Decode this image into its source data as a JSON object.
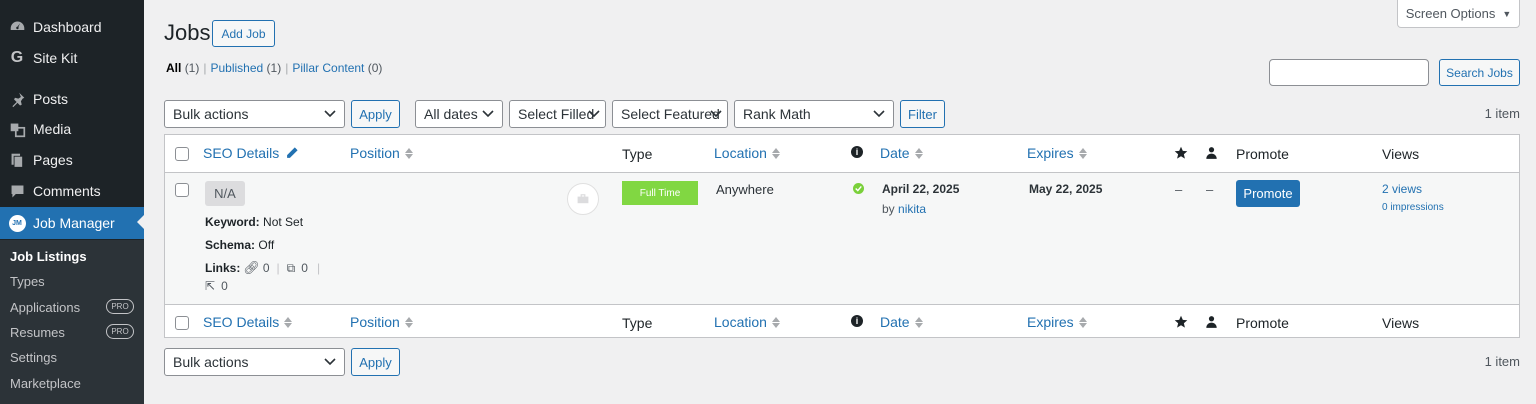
{
  "sidebar": {
    "items": [
      {
        "label": "Dashboard",
        "icon": "dashboard-icon"
      },
      {
        "label": "Site Kit",
        "icon": "google-g-icon"
      },
      {
        "label": "Posts",
        "icon": "pushpin-icon"
      },
      {
        "label": "Media",
        "icon": "media-icon"
      },
      {
        "label": "Pages",
        "icon": "pages-icon"
      },
      {
        "label": "Comments",
        "icon": "comment-icon"
      },
      {
        "label": "Job Manager",
        "icon": "jm-logo-icon"
      }
    ],
    "submenu": [
      {
        "label": "Job Listings"
      },
      {
        "label": "Types"
      },
      {
        "label": "Applications",
        "badge": "PRO"
      },
      {
        "label": "Resumes",
        "badge": "PRO"
      },
      {
        "label": "Settings"
      },
      {
        "label": "Marketplace"
      }
    ]
  },
  "screen_options": "Screen Options",
  "page": {
    "title": "Jobs",
    "add_new": "Add Job"
  },
  "views": {
    "all": "All",
    "all_count": "(1)",
    "published": "Published",
    "published_count": "(1)",
    "pillar": "Pillar Content",
    "pillar_count": "(0)",
    "sep": "|"
  },
  "search": {
    "value": "",
    "button": "Search Jobs"
  },
  "filters": {
    "bulk": "Bulk actions",
    "apply": "Apply",
    "dates": "All dates",
    "filled": "Select Filled",
    "featured": "Select Featured",
    "rankmath": "Rank Math",
    "filter": "Filter",
    "count": "1 item"
  },
  "columns": {
    "seo": "SEO Details",
    "position": "Position",
    "type": "Type",
    "location": "Location",
    "date": "Date",
    "expires": "Expires",
    "promote": "Promote",
    "views": "Views"
  },
  "row": {
    "seo_score": "N/A",
    "keyword_label": "Keyword:",
    "keyword_value": "Not Set",
    "schema_label": "Schema:",
    "schema_value": "Off",
    "links_label": "Links:",
    "internal_links": "0",
    "external_links": "0",
    "incoming_links": "0",
    "link_sep": "|",
    "type": "Full Time",
    "location": "Anywhere",
    "date": "April 22, 2025",
    "by": "by",
    "author": "nikita",
    "expires": "May 22, 2025",
    "featured": "–",
    "filled": "–",
    "promote_button": "Promote",
    "views": "2 views",
    "impressions": "0 impressions"
  },
  "bottom": {
    "bulk": "Bulk actions",
    "apply": "Apply",
    "count": "1 item"
  },
  "colors": {
    "accent": "#2271b1",
    "sidebar": "#1d2327",
    "type_badge": "#81d742"
  }
}
